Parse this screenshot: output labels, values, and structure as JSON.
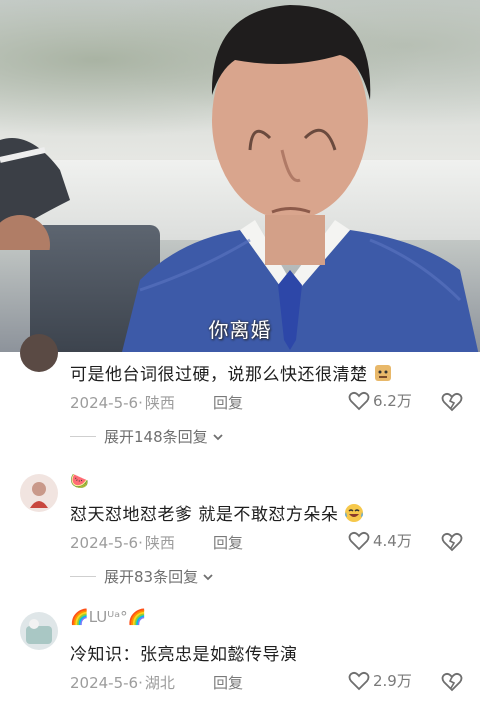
{
  "video": {
    "subtitle": "你离婚"
  },
  "comments": [
    {
      "username": "",
      "text": "可是他台词很过硬，说那么快还很清楚",
      "emoji_icon": "doge-emoji-icon",
      "date": "2024-5-6",
      "location": "陕西",
      "reply_label": "回复",
      "likes": "6.2万",
      "expand_label": "展开148条回复"
    },
    {
      "username": "🍉",
      "text": "怼天怼地怼老爹  就是不敢怼方朵朵",
      "emoji_icon": "laugh-cry-emoji-icon",
      "date": "2024-5-6",
      "location": "陕西",
      "reply_label": "回复",
      "likes": "4.4万",
      "expand_label": "展开83条回复"
    },
    {
      "username_prefix": "🌈",
      "username": "LUᵁᵃ°",
      "username_suffix": "🌈",
      "text": "冷知识：张亮忠是如懿传导演",
      "date": "2024-5-6",
      "location": "湖北",
      "reply_label": "回复",
      "likes": "2.9万"
    }
  ],
  "colors": {
    "text": "#1e1e1e",
    "meta": "#9c9c9c",
    "subtitle": "#ffffff"
  }
}
